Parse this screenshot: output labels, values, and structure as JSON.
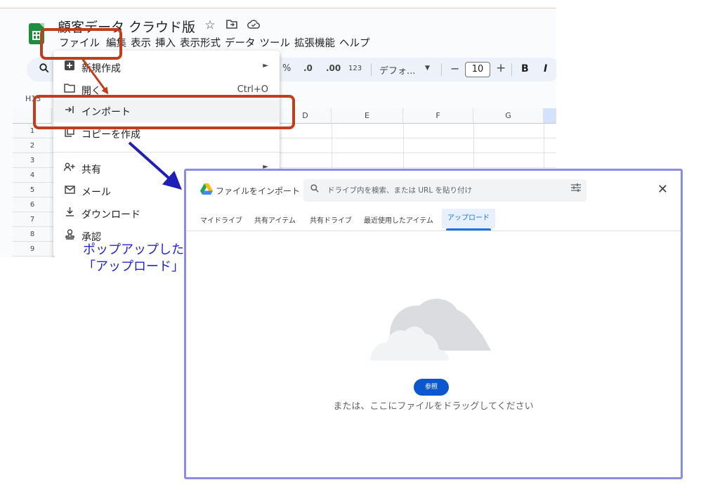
{
  "sheets": {
    "doc_title": "顧客データ クラウド版",
    "title_icons": [
      "star-icon",
      "move-folder-icon",
      "cloud-status-icon"
    ],
    "menu": [
      "ファイル",
      "編集",
      "表示",
      "挿入",
      "表示形式",
      "データ",
      "ツール",
      "拡張機能",
      "ヘルプ"
    ],
    "toolbar": {
      "percent": "%",
      "decimal_decrease": ".0",
      "decimal_increase": ".00",
      "number_format": "123",
      "font": "デフォ...",
      "minus": "−",
      "font_size": "10",
      "plus": "+",
      "bold": "B",
      "italic": "I"
    },
    "name_box": "H13",
    "columns": [
      "D",
      "E",
      "F",
      "G"
    ],
    "rows": [
      "1",
      "2",
      "3",
      "4",
      "5",
      "6",
      "7",
      "8",
      "9"
    ]
  },
  "file_menu": {
    "items": [
      {
        "icon": "add-box-icon",
        "label": "新規作成",
        "submenu": true
      },
      {
        "icon": "folder-open-icon",
        "label": "開く",
        "shortcut": "Ctrl+O"
      },
      {
        "icon": "import-icon",
        "label": "インポート"
      },
      {
        "icon": "copy-icon",
        "label": "コピーを作成"
      },
      {
        "icon": "person-add-icon",
        "label": "共有",
        "submenu": true
      },
      {
        "icon": "mail-icon",
        "label": "メール"
      },
      {
        "icon": "download-icon",
        "label": "ダウンロード"
      },
      {
        "icon": "approval-icon",
        "label": "承認"
      }
    ]
  },
  "annotation": {
    "line1": "ポップアップしたウィンドウで",
    "line2": "「アップロード」タブを選択"
  },
  "import_dialog": {
    "title": "ファイルをインポート",
    "search_placeholder": "ドライブ内を検索、または URL を貼り付け",
    "close": "✕",
    "tabs": [
      "マイドライブ",
      "共有アイテム",
      "共有ドライブ",
      "最近使用したアイテム",
      "アップロード"
    ],
    "active_tab": "アップロード",
    "browse_button": "参照",
    "drop_text": "または、ここにファイルをドラッグしてください"
  },
  "colors": {
    "annotation_red": "#c23d1d",
    "annotation_blue": "#1e1eb8",
    "primary_blue": "#0b57d0",
    "sheets_green": "#1e8e3e"
  }
}
